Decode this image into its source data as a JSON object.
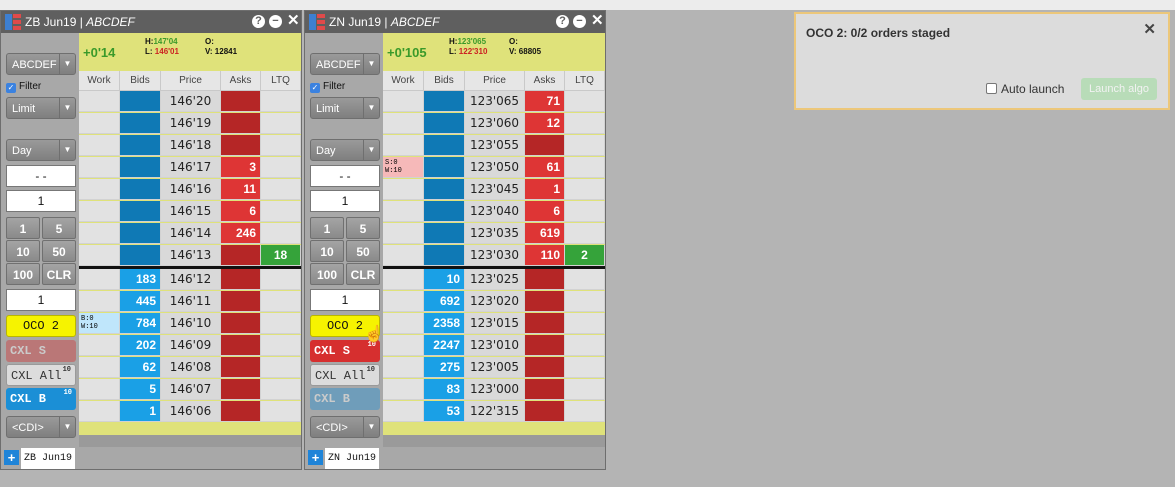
{
  "ladders": [
    {
      "symbol": "ZB Jun19",
      "account": "ABCDEF",
      "net_change": "+0'14",
      "high_label": "H:",
      "high": "147'04",
      "low_label": "L:",
      "low": "146'01",
      "open_label": "O:",
      "volume_label": "V:",
      "volume": "12841",
      "account_select": "ABCDEF",
      "filter_label": "Filter",
      "order_type": "Limit",
      "tif": "Day",
      "price_field": "- -",
      "qty_field": "1",
      "qty_buttons": [
        "1",
        "5",
        "10",
        "50",
        "100",
        "CLR"
      ],
      "position_field": "1",
      "oco_label": "OCO 2",
      "cxl_s_label": "CXL S",
      "cxl_s_count": "",
      "cxl_all_label": "CXL All",
      "cxl_all_count": "10",
      "cxl_b_label": "CXL B",
      "cxl_b_count": "10",
      "cxl_s_faded": true,
      "cxl_b_faded": false,
      "cdi_label": "<CDI>",
      "tab_label": "ZB Jun19",
      "headers": [
        "Work",
        "Bids",
        "Price",
        "Asks",
        "LTQ"
      ],
      "above_rows": [
        {
          "price": "146'20",
          "ask": "",
          "ltq": "",
          "work": ""
        },
        {
          "price": "146'19",
          "ask": "",
          "ltq": "",
          "work": ""
        },
        {
          "price": "146'18",
          "ask": "",
          "ltq": "",
          "work": ""
        },
        {
          "price": "146'17",
          "ask": "3",
          "ltq": "",
          "work": ""
        },
        {
          "price": "146'16",
          "ask": "11",
          "ltq": "",
          "work": ""
        },
        {
          "price": "146'15",
          "ask": "6",
          "ltq": "",
          "work": ""
        },
        {
          "price": "146'14",
          "ask": "246",
          "ltq": "",
          "work": ""
        },
        {
          "price": "146'13",
          "ask": "",
          "ltq": "18",
          "work": ""
        }
      ],
      "below_rows": [
        {
          "price": "146'12",
          "bid": "183",
          "work": ""
        },
        {
          "price": "146'11",
          "bid": "445",
          "work": ""
        },
        {
          "price": "146'10",
          "bid": "784",
          "work": "B:0\nW:10"
        },
        {
          "price": "146'09",
          "bid": "202",
          "work": ""
        },
        {
          "price": "146'08",
          "bid": "62",
          "work": ""
        },
        {
          "price": "146'07",
          "bid": "5",
          "work": ""
        },
        {
          "price": "146'06",
          "bid": "1",
          "work": ""
        }
      ]
    },
    {
      "symbol": "ZN Jun19",
      "account": "ABCDEF",
      "net_change": "+0'105",
      "high_label": "H:",
      "high": "123'065",
      "low_label": "L:",
      "low": "122'310",
      "open_label": "O:",
      "volume_label": "V:",
      "volume": "68805",
      "account_select": "ABCDEF",
      "filter_label": "Filter",
      "order_type": "Limit",
      "tif": "Day",
      "price_field": "- -",
      "qty_field": "1",
      "qty_buttons": [
        "1",
        "5",
        "10",
        "50",
        "100",
        "CLR"
      ],
      "position_field": "1",
      "oco_label": "OCO 2",
      "cxl_s_label": "CXL S",
      "cxl_s_count": "10",
      "cxl_all_label": "CXL All",
      "cxl_all_count": "10",
      "cxl_b_label": "CXL B",
      "cxl_b_count": "",
      "cxl_s_faded": false,
      "cxl_b_faded": true,
      "cdi_label": "<CDI>",
      "tab_label": "ZN Jun19",
      "headers": [
        "Work",
        "Bids",
        "Price",
        "Asks",
        "LTQ"
      ],
      "above_rows": [
        {
          "price": "123'065",
          "ask": "71",
          "ltq": "",
          "work": ""
        },
        {
          "price": "123'060",
          "ask": "12",
          "ltq": "",
          "work": ""
        },
        {
          "price": "123'055",
          "ask": "",
          "ltq": "",
          "work": ""
        },
        {
          "price": "123'050",
          "ask": "61",
          "ltq": "",
          "work": "S:0\nW:10"
        },
        {
          "price": "123'045",
          "ask": "1",
          "ltq": "",
          "work": ""
        },
        {
          "price": "123'040",
          "ask": "6",
          "ltq": "",
          "work": ""
        },
        {
          "price": "123'035",
          "ask": "619",
          "ltq": "",
          "work": ""
        },
        {
          "price": "123'030",
          "ask": "110",
          "ltq": "2",
          "work": ""
        }
      ],
      "below_rows": [
        {
          "price": "123'025",
          "bid": "10",
          "work": ""
        },
        {
          "price": "123'020",
          "bid": "692",
          "work": ""
        },
        {
          "price": "123'015",
          "bid": "2358",
          "work": ""
        },
        {
          "price": "123'010",
          "bid": "2247",
          "work": ""
        },
        {
          "price": "123'005",
          "bid": "275",
          "work": ""
        },
        {
          "price": "123'000",
          "bid": "83",
          "work": ""
        },
        {
          "price": "122'315",
          "bid": "53",
          "work": ""
        }
      ]
    }
  ],
  "oco_panel": {
    "title": "OCO 2: 0/2 orders staged",
    "auto_launch_label": "Auto launch",
    "launch_button": "Launch algo"
  },
  "colors": {
    "bid": "#0f79b5",
    "bid_active": "#1aa0e6",
    "ask": "#b52626",
    "ask_active": "#de3535",
    "ltq": "#35a33a",
    "header_yellow": "#dfe27a",
    "oco_yellow": "#f6f300"
  },
  "icons": [
    "help-icon",
    "minimize-icon",
    "close-icon",
    "add-icon",
    "hand-cursor-icon",
    "checkbox-icon"
  ]
}
